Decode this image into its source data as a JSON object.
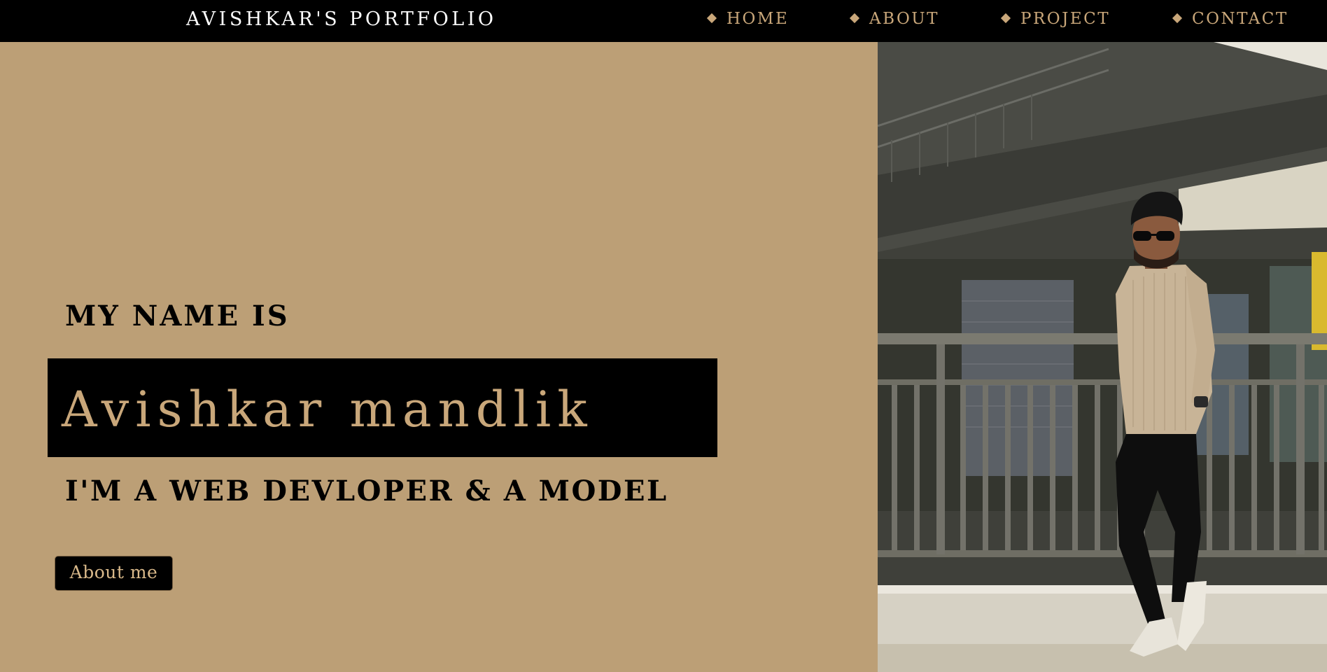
{
  "navbar": {
    "brand": "AVISHKAR'S  PORTFOLIO",
    "items": [
      {
        "label": "HOME"
      },
      {
        "label": "ABOUT"
      },
      {
        "label": "PROJECT"
      },
      {
        "label": "CONTACT"
      }
    ]
  },
  "hero": {
    "intro": "MY NAME IS",
    "name": "Avishkar mandlik",
    "role": "I'M A WEB DEVLOPER & A MODEL",
    "button_label": "About me"
  },
  "colors": {
    "navbar_bg": "#000000",
    "accent_gold": "#c9a77a",
    "hero_bg": "#bc9f76",
    "text_dark": "#000000"
  }
}
